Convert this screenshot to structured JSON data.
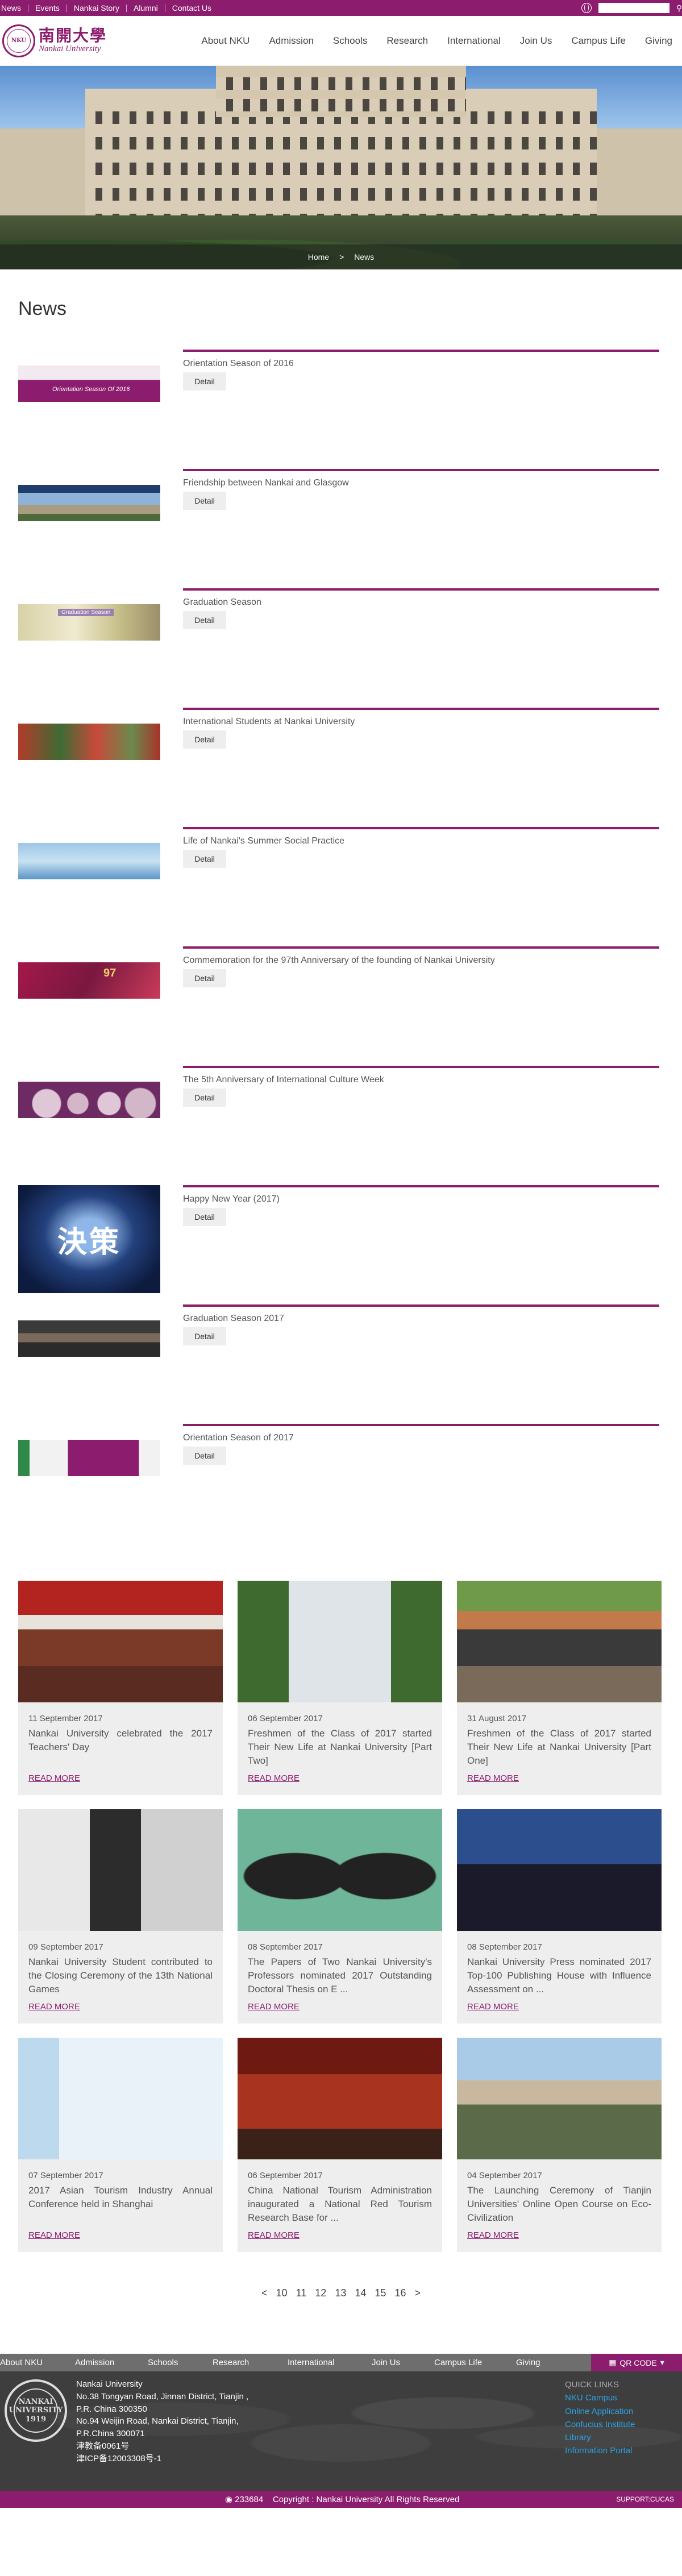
{
  "topbar": {
    "links": [
      "News",
      "Events",
      "Nankai Story",
      "Alumni",
      "Contact Us"
    ],
    "search_placeholder": "",
    "colors": {
      "brand": "#8c1d6e"
    }
  },
  "header": {
    "logo_cn": "南開大學",
    "logo_en": "Nankai University",
    "nav": [
      "About NKU",
      "Admission",
      "Schools",
      "Research",
      "International",
      "Join Us",
      "Campus Life",
      "Giving"
    ]
  },
  "hero": {
    "breadcrumb": [
      "Home",
      ">",
      "News"
    ]
  },
  "page": {
    "title": "News"
  },
  "news_items": [
    {
      "title": "Orientation Season of 2016",
      "button": "Detail",
      "thumb_text": "Orientation Season Of 2016"
    },
    {
      "title": "Friendship between Nankai and Glasgow",
      "button": "Detail",
      "thumb_text": ""
    },
    {
      "title": "Graduation Season",
      "button": "Detail",
      "thumb_text": "Graduation Season"
    },
    {
      "title": "International Students at Nankai University",
      "button": "Detail",
      "thumb_text": ""
    },
    {
      "title": "Life of Nankai's Summer Social Practice",
      "button": "Detail",
      "thumb_text": ""
    },
    {
      "title": "Commemoration for the 97th Anniversary of the founding of Nankai University",
      "button": "Detail",
      "thumb_text": "97"
    },
    {
      "title": "The 5th Anniversary of International Culture Week",
      "button": "Detail",
      "thumb_text": ""
    },
    {
      "title": "Happy New Year (2017)",
      "button": "Detail",
      "thumb_text": "決策"
    },
    {
      "title": "Graduation Season 2017",
      "button": "Detail",
      "thumb_text": ""
    },
    {
      "title": "Orientation Season of 2017",
      "button": "Detail",
      "thumb_text": ""
    }
  ],
  "cards": [
    {
      "date": "11 September 2017",
      "title": "Nankai University celebrated the 2017 Teachers' Day",
      "more": "READ MORE"
    },
    {
      "date": "06 September 2017",
      "title": "Freshmen of the Class of 2017 started Their New Life at Nankai University [Part Two]",
      "more": "READ MORE"
    },
    {
      "date": "31 August 2017",
      "title": "Freshmen of the Class of 2017 started Their New Life at Nankai University [Part One]",
      "more": "READ MORE"
    },
    {
      "date": "09 September 2017",
      "title": "Nankai University Student contributed to the Closing Ceremony of the 13th National Games",
      "more": "READ MORE"
    },
    {
      "date": "08 September 2017",
      "title": "The Papers of Two Nankai University's Professors nominated 2017 Outstanding Doctoral Thesis on E ...",
      "more": "READ MORE"
    },
    {
      "date": "08 September 2017",
      "title": "Nankai University Press nominated 2017 Top-100 Publishing House with Influence Assessment on ...",
      "more": "READ MORE"
    },
    {
      "date": "07 September 2017",
      "title": "2017 Asian Tourism Industry Annual Conference held in Shanghai",
      "more": "READ MORE"
    },
    {
      "date": "06 September 2017",
      "title": "China National Tourism Administration inaugurated a National Red Tourism Research Base for ...",
      "more": "READ MORE"
    },
    {
      "date": "04 September 2017",
      "title": "The Launching Ceremony of Tianjin Universities' Online Open Course on Eco-Civilization",
      "more": "READ MORE"
    }
  ],
  "pager": {
    "prev": "<",
    "pages": [
      "10",
      "11",
      "12",
      "13",
      "14",
      "15",
      "16"
    ],
    "next": ">"
  },
  "footer": {
    "nav": [
      "About NKU",
      "Admission",
      "Schools",
      "Research",
      "International",
      "Join Us",
      "Campus Life",
      "Giving"
    ],
    "qr_label": "QR CODE",
    "seal_text": "NANKAI UNIVERSITY 1919",
    "address_lines": [
      "Nankai University",
      "No.38 Tongyan Road, Jinnan District, Tianjin , P.R. China 300350",
      "No.94 Weijin Road, Nankai District, Tianjin, P.R.China 300071",
      "津教备0061号",
      "津ICP备12003308号-1"
    ],
    "links_head": "QUICK LINKS",
    "links": [
      "NKU Campus",
      "Online Application",
      "Confucius Institute",
      "Library",
      "Information Portal"
    ],
    "visits": "233684",
    "copyright": "Copyright : Nankai University All Rights Reserved",
    "support": "SUPPORT:CUCAS"
  }
}
